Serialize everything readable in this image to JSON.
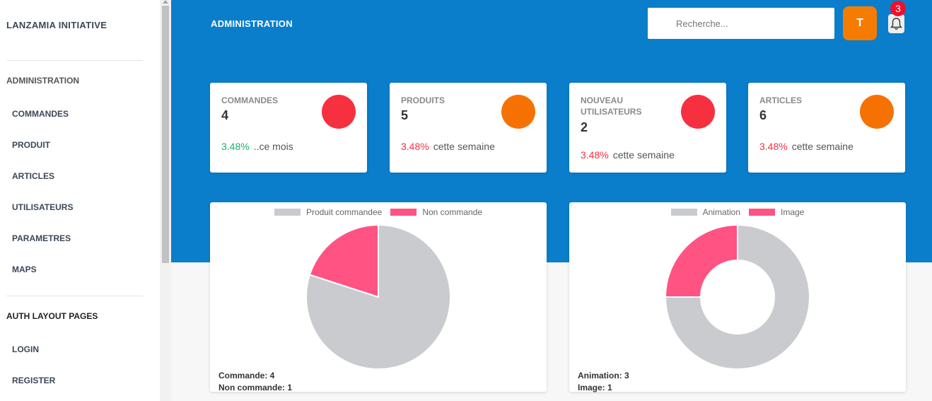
{
  "brand": "LANZAMIA INITIATIVE",
  "sidebar": {
    "section1": "ADMINISTRATION",
    "items": [
      "COMMANDES",
      "PRODUIT",
      "ARTICLES",
      "UTILISATEURS",
      "PARAMETRES",
      "MAPS"
    ],
    "section2": "AUTH LAYOUT PAGES",
    "auth_items": [
      "LOGIN",
      "REGISTER"
    ]
  },
  "header": {
    "title": "ADMINISTRATION",
    "search_placeholder": "Recherche...",
    "avatar_letter": "T",
    "notification_count": "3",
    "icon": "bell-icon"
  },
  "stats": [
    {
      "label": "COMMANDES",
      "value": "4",
      "pct": "3.48%",
      "period": "..ce mois",
      "pct_color": "#1cb36b",
      "circle_color": "#f6303f"
    },
    {
      "label": "PRODUITS",
      "value": "5",
      "pct": "3.48%",
      "period": "cette semaine",
      "pct_color": "#f6303f",
      "circle_color": "#f57202"
    },
    {
      "label": "NOUVEAU UTILISATEURS",
      "value": "2",
      "pct": "3.48%",
      "period": "cette semaine",
      "pct_color": "#f6303f",
      "circle_color": "#f6303f"
    },
    {
      "label": "ARTICLES",
      "value": "6",
      "pct": "3.48%",
      "period": "cette semaine",
      "pct_color": "#f6303f",
      "circle_color": "#f57202"
    }
  ],
  "chart_data": [
    {
      "type": "pie",
      "categories": [
        "Produit commandee",
        "Non commande"
      ],
      "values": [
        4,
        1
      ],
      "colors": [
        "#c9cbcf",
        "#ff5384"
      ],
      "legend": "top",
      "footer": [
        "Commande: 4",
        "Non commande: 1"
      ]
    },
    {
      "type": "doughnut",
      "categories": [
        "Animation",
        "Image"
      ],
      "values": [
        3,
        1
      ],
      "colors": [
        "#c9cbcf",
        "#ff5384"
      ],
      "legend": "top",
      "footer": [
        "Animation: 3",
        "Image: 1"
      ]
    }
  ]
}
